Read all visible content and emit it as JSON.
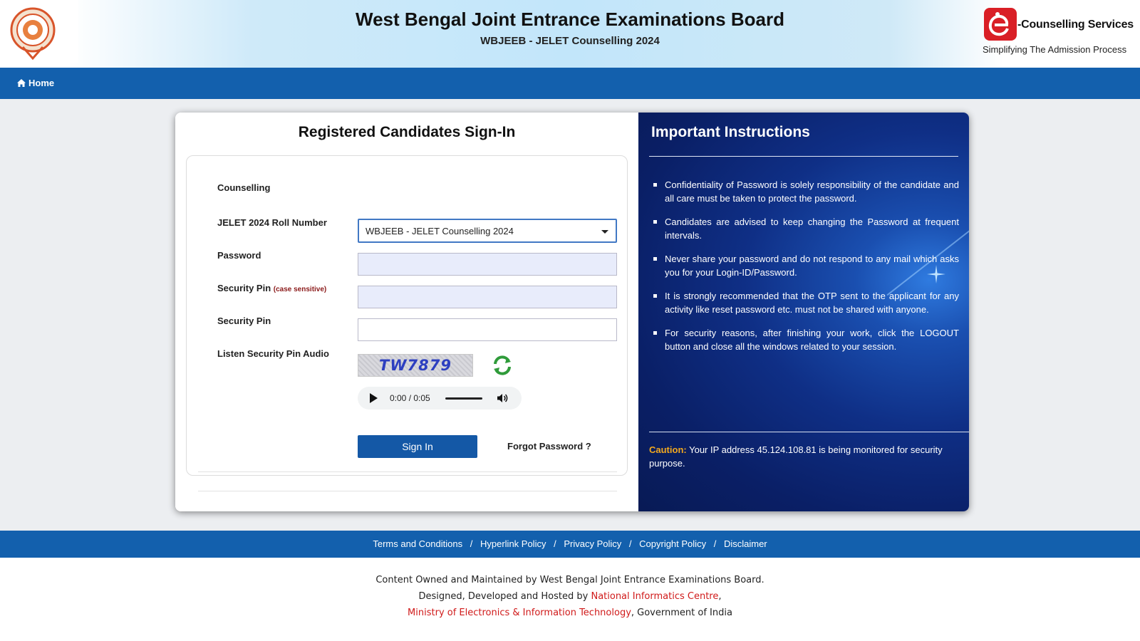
{
  "header": {
    "title": "West Bengal Joint Entrance Examinations Board",
    "subtitle": "WBJEEB - JELET Counselling 2024",
    "ec_title": "-Counselling Services",
    "ec_tagline": "Simplifying The Admission Process"
  },
  "nav": {
    "home_label": "Home"
  },
  "signin": {
    "title": "Registered Candidates Sign-In",
    "counselling_label": "Counselling",
    "counselling_value": "WBJEEB - JELET Counselling 2024",
    "roll_label": "JELET 2024 Roll Number",
    "roll_value": "",
    "password_label": "Password",
    "password_value": "",
    "pin_label": "Security Pin",
    "pin_hint": "(case sensitive)",
    "pin_value": "",
    "captcha_label": "Security Pin",
    "captcha_text": "TW7879",
    "audio_label": "Listen Security Pin Audio",
    "audio_time": "0:00 / 0:05",
    "signin_button": "Sign In",
    "forgot_link": "Forgot Password ?"
  },
  "instructions": {
    "title": "Important Instructions",
    "items": [
      "Confidentiality of Password is solely responsibility of the candidate and all care must be taken to protect the password.",
      "Candidates are advised to keep changing the Password at frequent intervals.",
      "Never share your password and do not respond to any mail which asks you for your Login-ID/Password.",
      "It is strongly recommended that the OTP sent to the applicant for any activity like reset password etc. must not be shared with anyone.",
      "For security reasons, after finishing your work, click the LOGOUT button and close all the windows related to your session."
    ],
    "caution_label": "Caution:",
    "caution_text": "Your IP address 45.124.108.81 is being monitored for security purpose."
  },
  "footer": {
    "links": [
      "Terms and Conditions",
      "Hyperlink Policy",
      "Privacy Policy",
      "Copyright Policy",
      "Disclaimer"
    ],
    "separator": "/",
    "line1": "Content Owned and Maintained by West Bengal Joint Entrance Examinations Board.",
    "line2_prefix": "Designed, Developed and Hosted by",
    "nic": "National Informatics Centre",
    "line2_suffix": ",",
    "meity": "Ministry of Electronics & Information Technology",
    "line3_suffix": ", Government of India"
  },
  "colors": {
    "nav_blue": "#1360ad",
    "button_blue": "#1458a6",
    "caution_orange": "#f3a91e",
    "footer_red": "#d01a1a",
    "panel_navy": "#0a1f66"
  },
  "icons": {
    "home": "home-icon",
    "refresh": "refresh-icon",
    "play": "play-icon",
    "volume": "volume-icon",
    "dropdown": "chevron-down-icon"
  }
}
